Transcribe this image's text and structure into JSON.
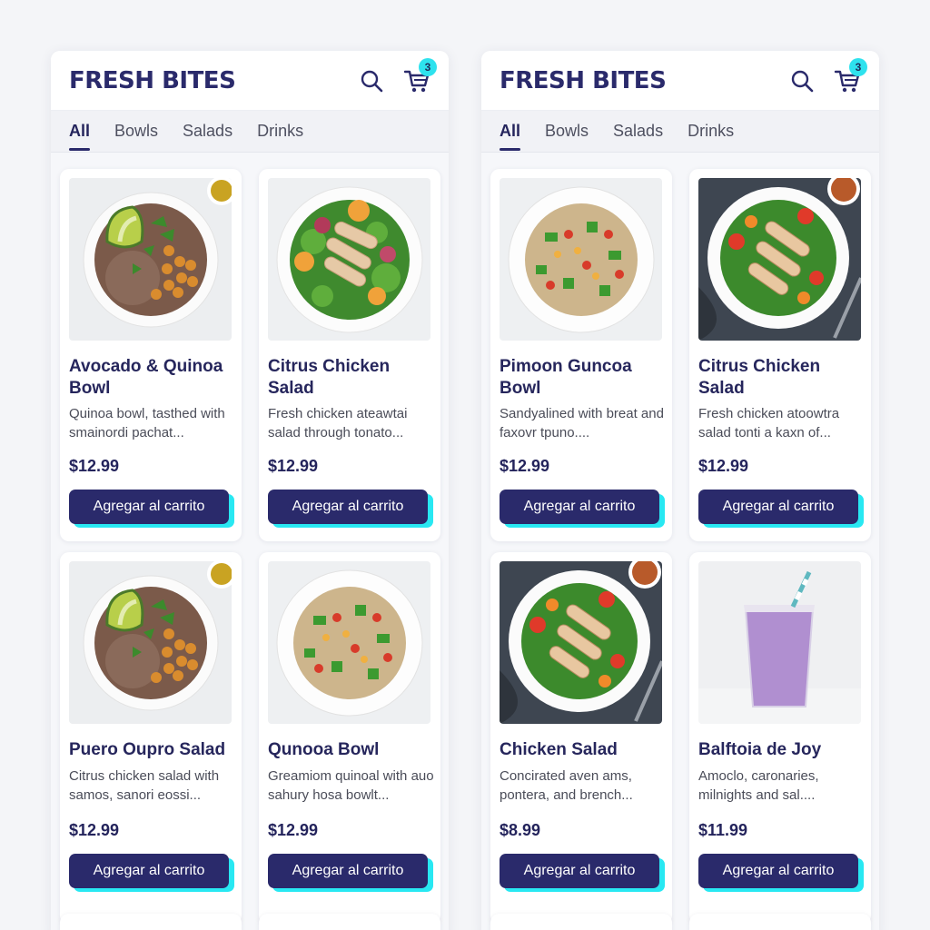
{
  "brand": "FRESH BITES",
  "cart_count": "3",
  "tabs": [
    "All",
    "Bowls",
    "Salads",
    "Drinks"
  ],
  "add_to_cart_label": "Agregar al carrito",
  "colors": {
    "primary": "#2a2a6b",
    "accent": "#28e8f2",
    "badge": "#2ee2ee"
  },
  "icons": {
    "search": "search-icon",
    "cart": "cart-icon"
  },
  "left_products": [
    {
      "name": "Avocado & Quinoa Bowl",
      "desc": "Quinoa bowl, tasthed with smainordi pachat...",
      "price": "$12.99",
      "image": "avocado-chickpea-bowl"
    },
    {
      "name": "Citrus Chicken Salad",
      "desc": "Fresh chicken ateawtai salad through tonato...",
      "price": "$12.99",
      "image": "citrus-chicken-salad"
    },
    {
      "name": "Puero Oupro Salad",
      "desc": "Citrus chicken salad with samos, sanori eossi...",
      "price": "$12.99",
      "image": "avocado-chickpea-bowl"
    },
    {
      "name": "Qunooa Bowl",
      "desc": "Greamiom quinoal with auo sahury hosa bowlt...",
      "price": "$12.99",
      "image": "quinoa-salad"
    }
  ],
  "right_products": [
    {
      "name": "Pimoon Guncoa Bowl",
      "desc": "Sandyalined with breat and faxovr tpuno....",
      "price": "$12.99",
      "image": "quinoa-salad"
    },
    {
      "name": "Citrus Chicken Salad",
      "desc": "Fresh chicken atoowtra salad tonti a kaxn of...",
      "price": "$12.99",
      "image": "chicken-salad-dark"
    },
    {
      "name": "Chicken Salad",
      "desc": "Concirated aven ams, pontera, and brench...",
      "price": "$8.99",
      "image": "chicken-salad-dark"
    },
    {
      "name": "Balftoia de Joy",
      "desc": "Amoclo, caronaries, milnights and sal....",
      "price": "$11.99",
      "image": "berry-smoothie"
    }
  ]
}
